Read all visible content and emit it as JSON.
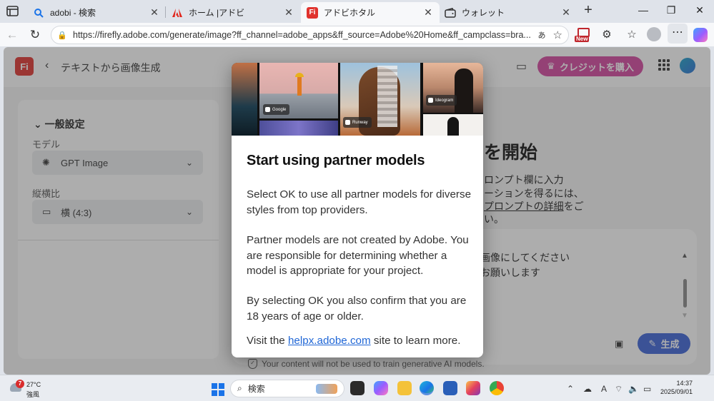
{
  "browser": {
    "tabs": [
      {
        "title": "adobi - 検索",
        "active": false,
        "favicon": "search-icon"
      },
      {
        "title": "ホーム |アドビ",
        "active": false,
        "favicon": "adobe-icon"
      },
      {
        "title": "アドビホタル",
        "active": true,
        "favicon": "firefly-icon",
        "favicon_text": "Fi"
      },
      {
        "title": "ウォレット",
        "active": false,
        "favicon": "wallet-icon"
      }
    ],
    "url": "https://firefly.adobe.com/generate/image?ff_channel=adobe_apps&ff_source=Adobe%20Home&ff_campclass=bra...",
    "translate_label": "あ",
    "new_badge": "New",
    "accent_color": "#1a73e8"
  },
  "app": {
    "logo_text": "Fi",
    "title": "テキストから画像生成",
    "credits_button": "クレジットを購入",
    "generate_button": "生成",
    "colors": {
      "credits": "#d4469f",
      "generate": "#3b63d8",
      "logo": "#e0322d"
    }
  },
  "settings_panel": {
    "section_title": "一般設定",
    "model_label": "モデル",
    "model_value": "GPT Image",
    "aspect_label": "縦横比",
    "aspect_value": "横 (4:3)"
  },
  "background": {
    "heading": "を開始",
    "lines": [
      "ロンプト欄に入力",
      "ーションを得るには、",
      "い。"
    ],
    "link": "プロンプトの詳細",
    "link_suffix": "をご",
    "prompt_lines": [
      "画像にしてください",
      "お願いします"
    ],
    "footer_note": "Your content will not be used to train generative AI models."
  },
  "modal": {
    "providers": [
      "Google",
      "Runway",
      "Ideogram"
    ],
    "title": "Start using partner models",
    "para1": "Select OK to use all partner models for diverse styles from top providers.",
    "para2": "Partner models are not created by Adobe. You are responsible for determining whether a model is appropriate for your project.",
    "para3": "By selecting OK you also confirm that you are 18 years of age or older.",
    "visit_prefix": "Visit the ",
    "visit_link": "helpx.adobe.com",
    "visit_suffix": " site to learn more."
  },
  "taskbar": {
    "weather_temp": "27°C",
    "weather_desc": "強風",
    "weather_badge": "7",
    "search_placeholder": "検索",
    "ime": "A",
    "time": "14:37",
    "date": "2025/09/01"
  }
}
